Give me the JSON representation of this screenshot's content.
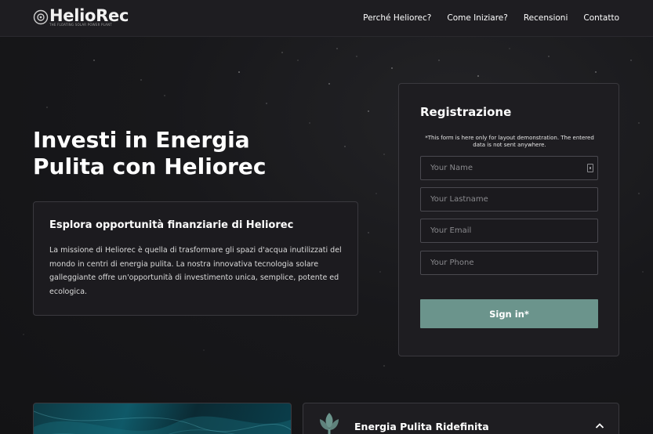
{
  "brand": {
    "name": "HelioRec",
    "tagline": "THE FLOATING SOLAR POWER PLANT"
  },
  "nav": {
    "items": [
      {
        "label": "Perché Heliorec?"
      },
      {
        "label": "Come Iniziare?"
      },
      {
        "label": "Recensioni"
      },
      {
        "label": "Contatto"
      }
    ]
  },
  "hero": {
    "headline": "Investi in Energia Pulita con Heliorec"
  },
  "info": {
    "title": "Esplora opportunità finanziarie di Heliorec",
    "body": "La missione di Heliorec è quella di trasformare gli spazi d'acqua inutilizzati del mondo in centri di energia pulita. La nostra innovativa tecnologia solare galleggiante offre un'opportunità di investimento unica, semplice, potente ed ecologica."
  },
  "form": {
    "title": "Registrazione",
    "note": "*This form is here only for layout demonstration. The entered data is not sent anywhere.",
    "fields": {
      "name": {
        "placeholder": "Your Name",
        "value": ""
      },
      "lastname": {
        "placeholder": "Your Lastname",
        "value": ""
      },
      "email": {
        "placeholder": "Your Email",
        "value": ""
      },
      "phone": {
        "placeholder": "Your Phone",
        "value": ""
      }
    },
    "submit_label": "Sign in*"
  },
  "accordion": {
    "title": "Energia Pulita Ridefinita",
    "icon": "solar-leaf-icon",
    "expanded": true
  },
  "colors": {
    "accent": "#6b948c",
    "background": "#141416",
    "card": "#1e1d21"
  }
}
